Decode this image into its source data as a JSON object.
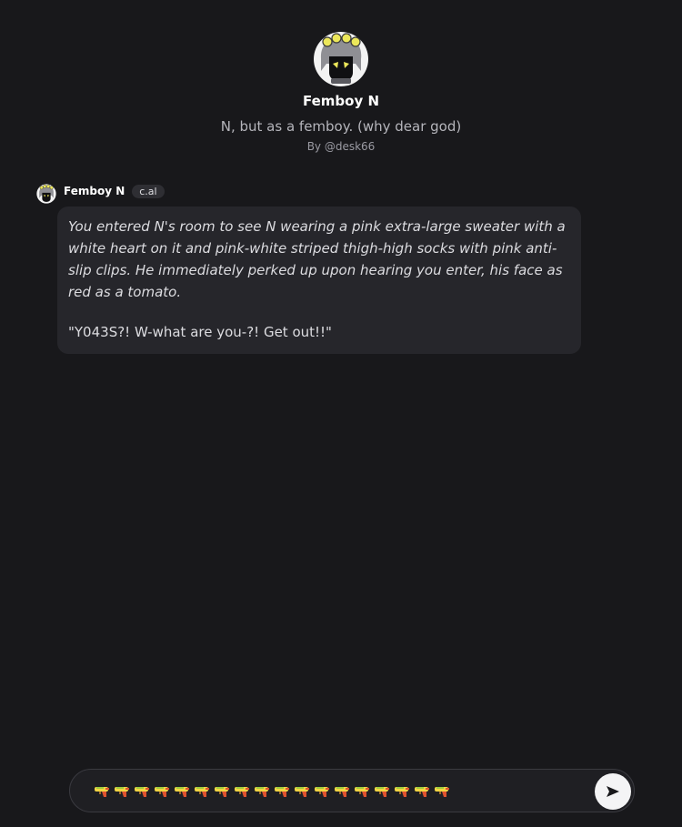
{
  "character": {
    "name": "Femboy N",
    "tagline": "N, but as a femboy. (why dear god)",
    "author": "By @desk66",
    "avatar_icon": "character-avatar-icon"
  },
  "message": {
    "author": "Femboy N",
    "badge": "c.al",
    "narration": "You entered N's room to see N wearing a pink extra-large sweater with a white heart on it and pink-white striped thigh-high socks with pink anti-slip clips. He immediately perked up upon hearing you enter, his face as red as a tomato.",
    "speech": "\"Y043S?! W-what are you-?! Get out!!\""
  },
  "composer": {
    "value_emoji": "water-pistol",
    "value_emoji_count": 18,
    "send_icon": "send-arrow-icon"
  },
  "colors": {
    "background": "#18181b",
    "bubble": "#26262b",
    "send_button": "#f4f4f5",
    "avatar_accent": "#ece75a"
  }
}
